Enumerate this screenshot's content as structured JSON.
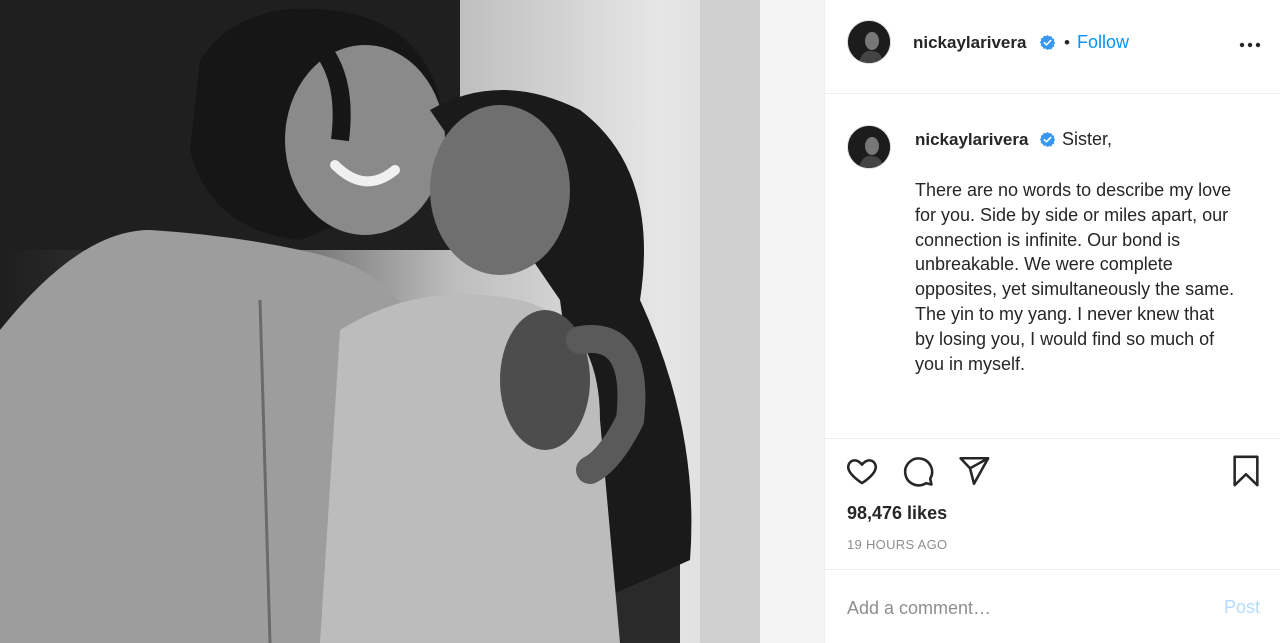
{
  "post": {
    "photo_alt": "",
    "username": "nickaylarivera",
    "verified_icon": "verified-badge-icon",
    "dot": "•",
    "follow_label": "Follow",
    "more_icon": "more-options-icon"
  },
  "caption": {
    "username": "nickaylarivera",
    "first_line": "Sister,",
    "body": "There are no words to describe my love for you. Side by side or miles apart, our connection is infinite. Our bond is unbreakable. We were complete opposites, yet simultaneously the same. The yin to my yang. I never knew that by losing you, I would find so much of you in myself."
  },
  "actions": {
    "like_icon": "heart-icon",
    "comment_icon": "comment-icon",
    "share_icon": "share-icon",
    "save_icon": "bookmark-icon",
    "likes_text": "98,476 likes",
    "time_text": "19 HOURS AGO"
  },
  "comment_box": {
    "placeholder": "Add a comment…",
    "post_label": "Post"
  },
  "colors": {
    "link_blue": "#0095f6",
    "post_disabled": "#b3dbff",
    "muted": "#8e8e8e",
    "text": "#262626"
  }
}
